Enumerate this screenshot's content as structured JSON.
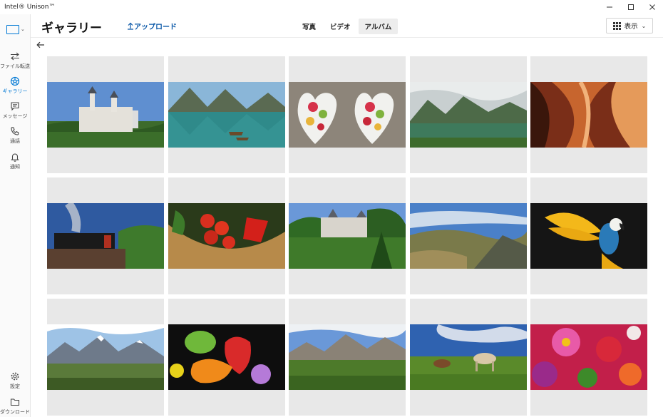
{
  "window": {
    "title": "Intel® Unison™"
  },
  "sidebar": {
    "items": [
      {
        "label": "ファイル転送",
        "icon": "transfer-icon"
      },
      {
        "label": "ギャラリー",
        "icon": "gallery-icon",
        "active": true
      },
      {
        "label": "メッセージ",
        "icon": "message-icon"
      },
      {
        "label": "通話",
        "icon": "phone-icon"
      },
      {
        "label": "通知",
        "icon": "bell-icon"
      }
    ],
    "bottom": [
      {
        "label": "設定",
        "icon": "gear-icon"
      },
      {
        "label": "ダウンロード",
        "icon": "folder-icon"
      }
    ]
  },
  "header": {
    "title": "ギャラリー",
    "upload_label": "アップロード",
    "tabs": [
      "写真",
      "ビデオ",
      "アルバム"
    ],
    "selected_tab": "アルバム",
    "view_label": "表示"
  },
  "colors": {
    "accent": "#0078d4",
    "placeholder": "#e8e8e8"
  },
  "gallery": {
    "images": [
      "castle-neuschwanstein",
      "mountain-lake-boats",
      "fruit-heart-bowls",
      "valley-lake",
      "antelope-canyon",
      "steam-train-bridge",
      "vegetable-basket",
      "castle-garden",
      "mountain-cliff-clouds",
      "macaw-parrot",
      "snowy-mountains-meadow",
      "fruits-flowers",
      "alpine-valley",
      "horses-grazing",
      "colorful-flowers"
    ]
  }
}
